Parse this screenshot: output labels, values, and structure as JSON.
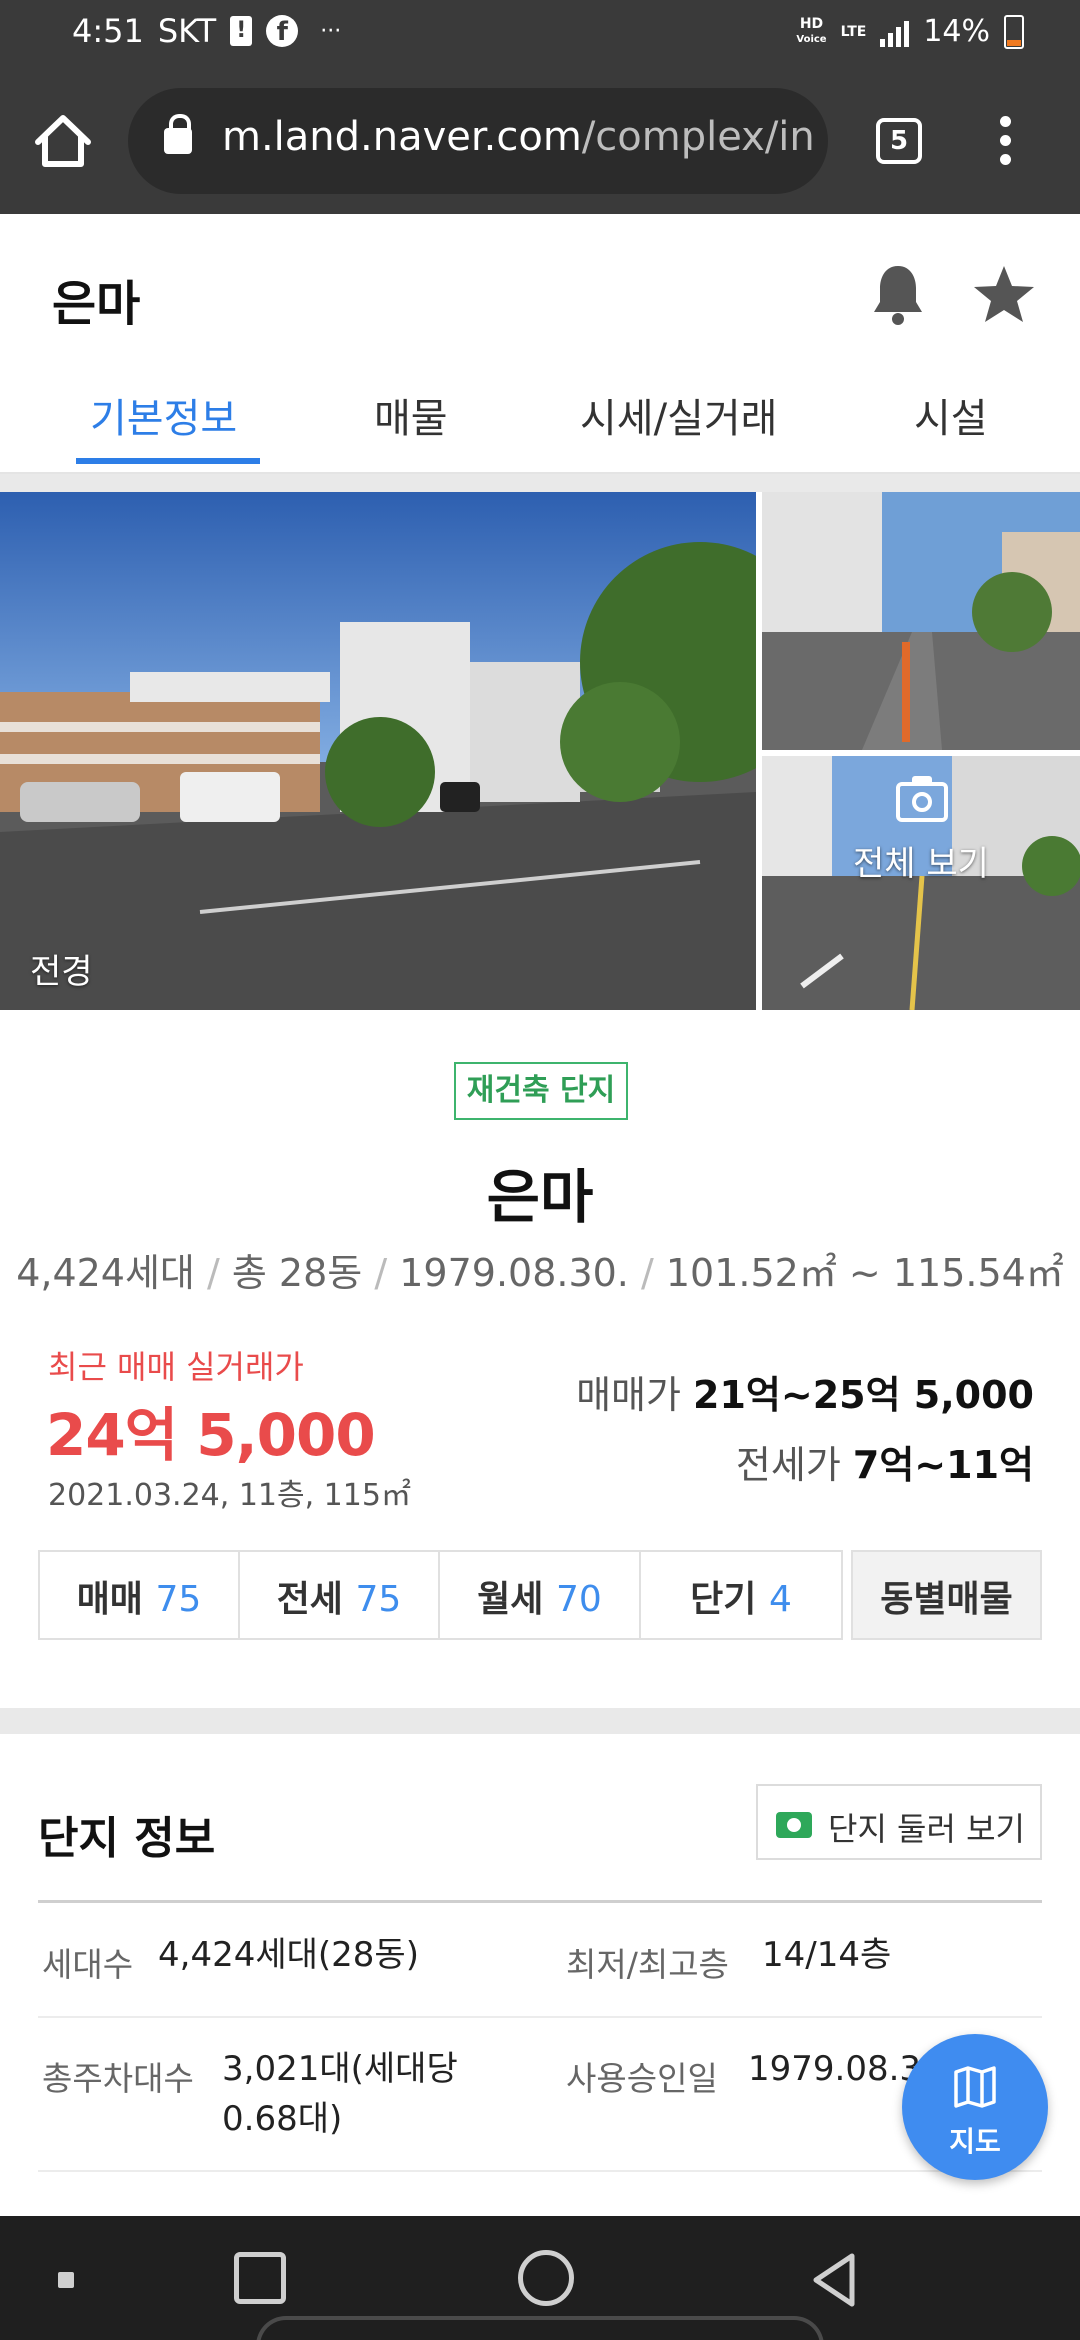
{
  "status_bar": {
    "time": "4:51",
    "carrier": "SKT",
    "notif_glyph": "!",
    "fb_glyph": "f",
    "more": "···",
    "hd_line1": "HD",
    "hd_line2": "Voice",
    "lte": "LTE",
    "battery": "14%"
  },
  "browser": {
    "url_host": "m.land.naver.com",
    "url_path": "/complex/info",
    "tab_count": "5"
  },
  "header": {
    "title": "은마",
    "tabs": [
      {
        "label": "기본정보",
        "active": true
      },
      {
        "label": "매물",
        "active": false
      },
      {
        "label": "시세/실거래",
        "active": false
      },
      {
        "label": "시설",
        "active": false
      }
    ]
  },
  "photos": {
    "main_label": "전경",
    "view_all": "전체 보기"
  },
  "summary": {
    "badge": "재건축 단지",
    "name": "은마",
    "households": "4,424세대",
    "buildings": "총 28동",
    "approval_date": "1979.08.30.",
    "area_range": "101.52㎡ ~ 115.54㎡",
    "recent_label": "최근 매매 실거래가",
    "recent_price": "24억 5,000",
    "recent_detail": "2021.03.24, 11층, 115㎡",
    "sale_label": "매매가",
    "sale_range": "21억~25억 5,000",
    "jeonse_label": "전세가",
    "jeonse_range": "7억~11억"
  },
  "counts": [
    {
      "label": "매매",
      "value": "75"
    },
    {
      "label": "전세",
      "value": "75"
    },
    {
      "label": "월세",
      "value": "70"
    },
    {
      "label": "단기",
      "value": "4"
    }
  ],
  "dong_button": "동별매물",
  "complex_info": {
    "title": "단지 정보",
    "tour_button": "단지 둘러 보기",
    "rows": [
      {
        "label": "세대수",
        "value": "4,424세대(28동)"
      },
      {
        "label": "최저/최고층",
        "value": "14/14층"
      },
      {
        "label": "총주차대수",
        "value": "3,021대(세대당 0.68대)"
      },
      {
        "label": "사용승인일",
        "value": "1979.08.3"
      }
    ]
  },
  "map_fab": {
    "label": "지도"
  },
  "colors": {
    "accent": "#2d7ee7",
    "price_red": "#e94b4b",
    "badge_green": "#2f9e56",
    "count_blue": "#3e8ded",
    "fab_blue": "#3f8cf0"
  },
  "icons": [
    "home-icon",
    "lock-icon",
    "tabs-icon",
    "more-vert-icon",
    "bell-icon",
    "star-icon",
    "camera-icon",
    "map-icon",
    "recents-icon",
    "home-circle-icon",
    "back-icon"
  ]
}
